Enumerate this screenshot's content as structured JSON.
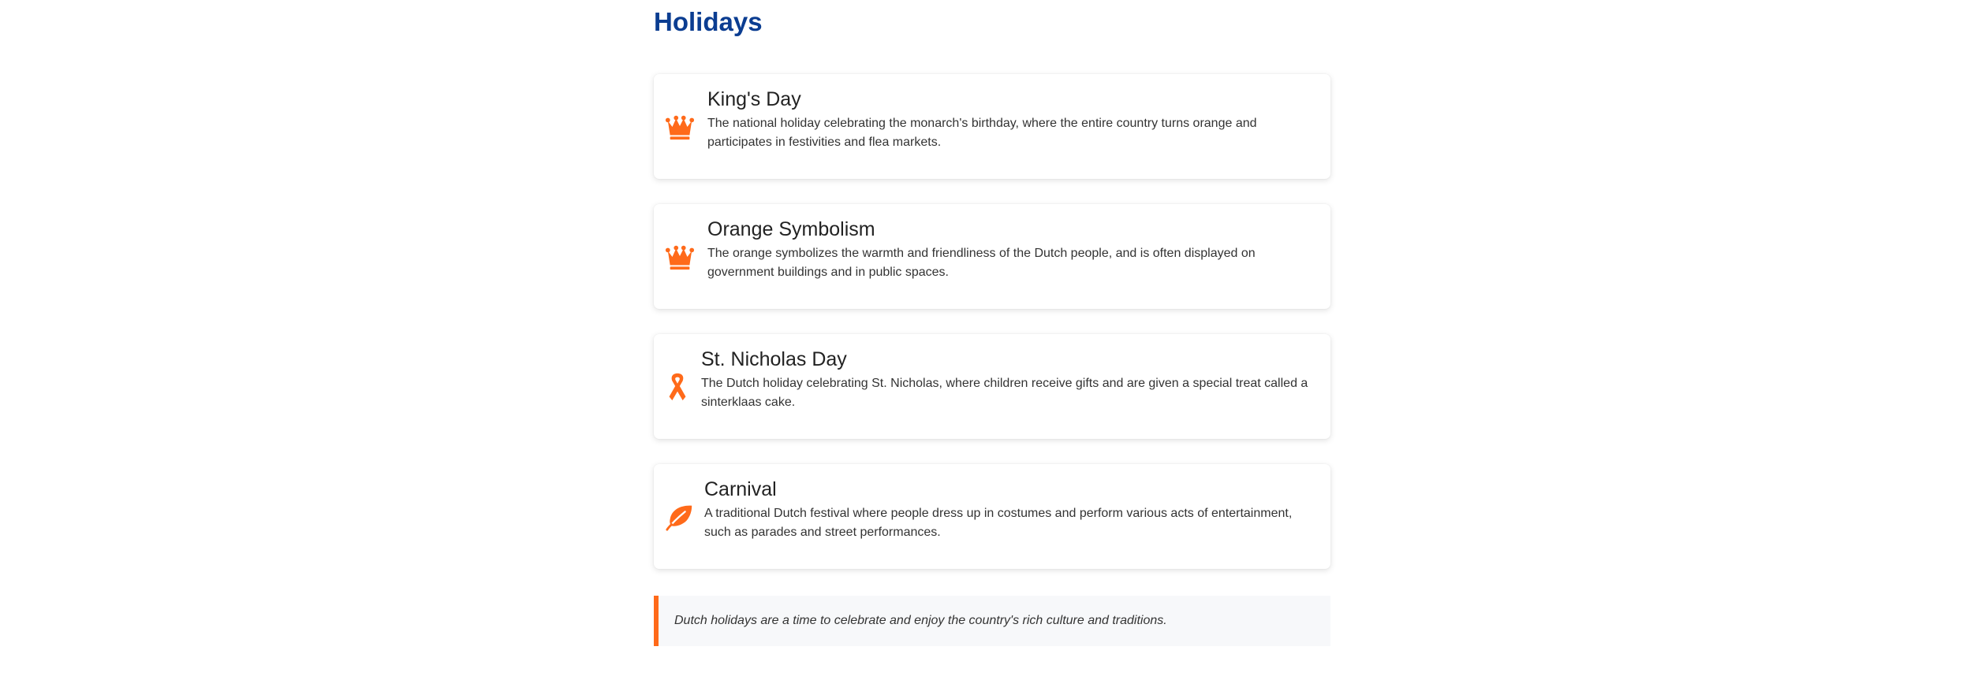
{
  "page": {
    "title": "Holidays"
  },
  "colors": {
    "title": "#0b3d91",
    "accent": "#ff6a1a"
  },
  "holidays": [
    {
      "icon": "crown-icon",
      "title": "King's Day",
      "description": "The national holiday celebrating the monarch's birthday, where the entire country turns orange and participates in festivities and flea markets."
    },
    {
      "icon": "crown-icon",
      "title": "Orange Symbolism",
      "description": "The orange symbolizes the warmth and friendliness of the Dutch people, and is often displayed on government buildings and in public spaces."
    },
    {
      "icon": "ribbon-icon",
      "title": "St. Nicholas Day",
      "description": "The Dutch holiday celebrating St. Nicholas, where children receive gifts and are given a special treat called a sinterklaas cake."
    },
    {
      "icon": "leaf-icon",
      "title": "Carnival",
      "description": "A traditional Dutch festival where people dress up in costumes and perform various acts of entertainment, such as parades and street performances."
    }
  ],
  "footer": {
    "note": "Dutch holidays are a time to celebrate and enjoy the country's rich culture and traditions."
  }
}
